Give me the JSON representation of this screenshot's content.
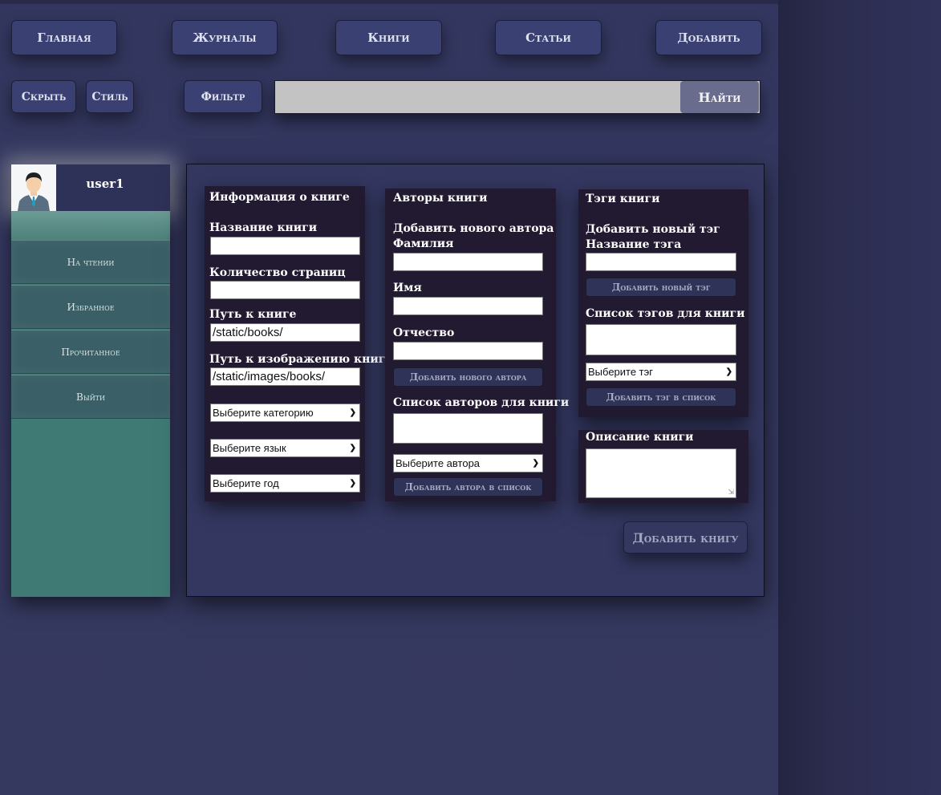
{
  "nav": {
    "home": "Главная",
    "journals": "Журналы",
    "books": "Книги",
    "articles": "Статьи",
    "add": "Добавить"
  },
  "toolbar": {
    "hide": "Скрыть",
    "style": "Стиль",
    "filter": "Фильтр",
    "search_value": "",
    "search_button": "Найти"
  },
  "sidebar": {
    "username": "user1",
    "items": [
      {
        "label": "На чтении"
      },
      {
        "label": "Избранное"
      },
      {
        "label": "Прочитанное"
      },
      {
        "label": "Выйти"
      }
    ]
  },
  "book_info": {
    "heading": "Информация о книге",
    "title_label": "Название книги",
    "title_value": "",
    "pages_label": "Количество страниц",
    "pages_value": "",
    "path_label": "Путь к книге",
    "path_value": "/static/books/",
    "image_label": "Путь к изображению книги",
    "image_value": "/static/images/books/",
    "category_select": "Выберите категорию",
    "language_select": "Выберите язык",
    "year_select": "Выберите год"
  },
  "authors": {
    "heading": "Авторы книги",
    "add_new_label": "Добавить нового автора",
    "surname_label": "Фамилия",
    "name_label": "Имя",
    "patronymic_label": "Отчество",
    "add_new_button": "Добавить нового автора",
    "list_label": "Список авторов для книги",
    "author_select": "Выберите автора",
    "add_to_list_button": "Добавить автора в список"
  },
  "tags": {
    "heading": "Тэги книги",
    "add_new_label": "Добавить новый тэг",
    "tag_name_label": "Название тэга",
    "add_new_button": "Добавить новый тэг",
    "list_label": "Список тэгов для книги",
    "tag_select": "Выберите тэг",
    "add_to_list_button": "Добавить тэг в список"
  },
  "description": {
    "heading": "Описание книги"
  },
  "submit": {
    "label": "Добавить книгу"
  }
}
